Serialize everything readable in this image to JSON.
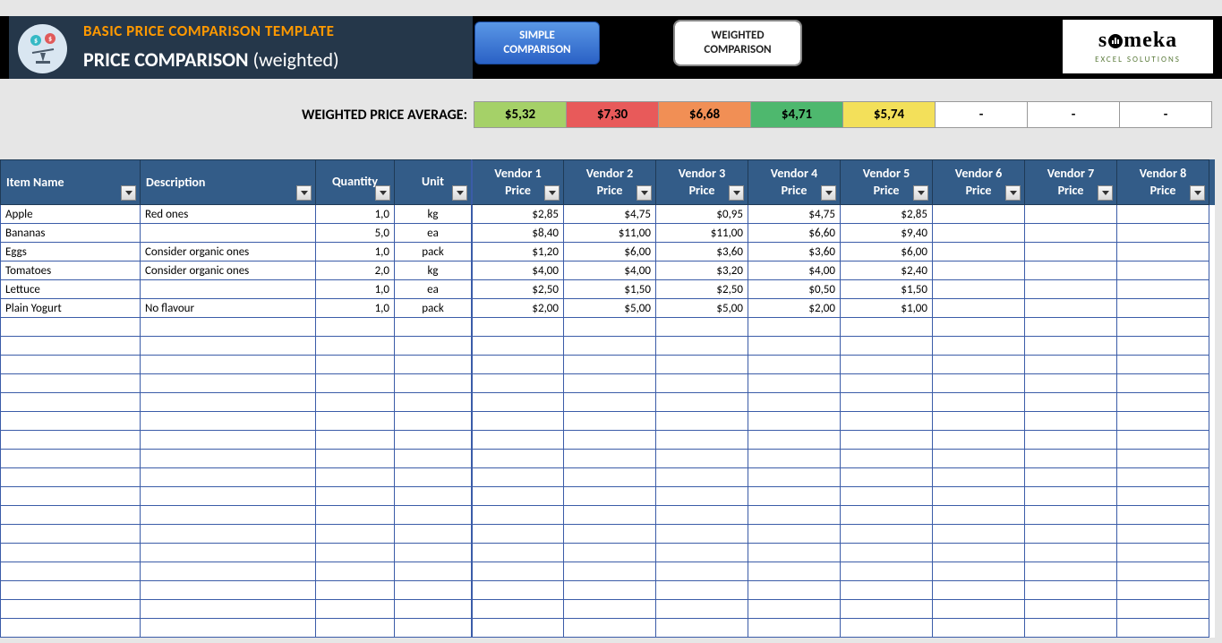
{
  "header": {
    "template_title": "BASIC PRICE COMPARISON TEMPLATE",
    "page_title_main": "PRICE COMPARISON",
    "page_title_sub": "(weighted)",
    "nav_simple_l1": "SIMPLE",
    "nav_simple_l2": "COMPARISON",
    "nav_weighted_l1": "WEIGHTED",
    "nav_weighted_l2": "COMPARISON",
    "logo_main": "someka",
    "logo_tag": "Excel Solutions"
  },
  "avg": {
    "label": "WEIGHTED PRICE AVERAGE:",
    "cells": [
      {
        "text": "$5,32",
        "bg": "#a5d168"
      },
      {
        "text": "$7,30",
        "bg": "#e85a5a"
      },
      {
        "text": "$6,68",
        "bg": "#f18f55"
      },
      {
        "text": "$4,71",
        "bg": "#4eb86e"
      },
      {
        "text": "$5,74",
        "bg": "#f3e05a"
      },
      {
        "text": "-",
        "bg": "#ffffff"
      },
      {
        "text": "-",
        "bg": "#ffffff"
      },
      {
        "text": "-",
        "bg": "#ffffff"
      }
    ]
  },
  "columns": {
    "item": "Item Name",
    "desc": "Description",
    "qty": "Quantity",
    "unit": "Unit",
    "vendors": [
      {
        "l1": "Vendor 1",
        "l2": "Price"
      },
      {
        "l1": "Vendor 2",
        "l2": "Price"
      },
      {
        "l1": "Vendor 3",
        "l2": "Price"
      },
      {
        "l1": "Vendor 4",
        "l2": "Price"
      },
      {
        "l1": "Vendor 5",
        "l2": "Price"
      },
      {
        "l1": "Vendor 6",
        "l2": "Price"
      },
      {
        "l1": "Vendor 7",
        "l2": "Price"
      },
      {
        "l1": "Vendor 8",
        "l2": "Price"
      }
    ]
  },
  "rows": [
    {
      "item": "Apple",
      "desc": "Red ones",
      "qty": "1,0",
      "unit": "kg",
      "prices": [
        "$2,85",
        "$4,75",
        "$0,95",
        "$4,75",
        "$2,85",
        "",
        "",
        ""
      ]
    },
    {
      "item": "Bananas",
      "desc": "",
      "qty": "5,0",
      "unit": "ea",
      "prices": [
        "$8,40",
        "$11,00",
        "$11,00",
        "$6,60",
        "$9,40",
        "",
        "",
        ""
      ]
    },
    {
      "item": "Eggs",
      "desc": "Consider organic ones",
      "qty": "1,0",
      "unit": "pack",
      "prices": [
        "$1,20",
        "$6,00",
        "$3,60",
        "$3,60",
        "$6,00",
        "",
        "",
        ""
      ]
    },
    {
      "item": "Tomatoes",
      "desc": "Consider organic ones",
      "qty": "2,0",
      "unit": "kg",
      "prices": [
        "$4,00",
        "$4,00",
        "$3,20",
        "$4,00",
        "$2,40",
        "",
        "",
        ""
      ]
    },
    {
      "item": "Lettuce",
      "desc": "",
      "qty": "1,0",
      "unit": "ea",
      "prices": [
        "$2,50",
        "$1,50",
        "$2,50",
        "$0,50",
        "$1,50",
        "",
        "",
        ""
      ]
    },
    {
      "item": "Plain Yogurt",
      "desc": "No flavour",
      "qty": "1,0",
      "unit": "pack",
      "prices": [
        "$2,00",
        "$5,00",
        "$5,00",
        "$2,00",
        "$1,00",
        "",
        "",
        ""
      ]
    }
  ],
  "empty_row_count": 17
}
